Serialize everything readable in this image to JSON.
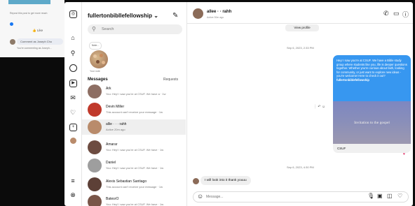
{
  "background": {
    "line1": "Repost this post to get more reach",
    "like_label": "Like",
    "comment_as": "Comment as Joseph Cho",
    "commenting_note": "You're commenting as Joseph..."
  },
  "sidebar_list": {
    "account_name": "fullertonbibllefellowship",
    "search_placeholder": "Search",
    "note_bubble": "Note...",
    "note_label": "Your note",
    "messages_header": "Messages",
    "requests_header": "Requests"
  },
  "conversations": [
    {
      "name": "Ark",
      "preview": "You: Hey! I saw you're at CSUF. We have a · 1w",
      "color": "#8d6e63"
    },
    {
      "name": "Devin Miller",
      "preview": "This account can't receive your message · 1w",
      "color": "#c0392b"
    },
    {
      "name": "allie  ·  ·  ·  rahh",
      "preview": "Active 20m ago",
      "color": "#b98b6b"
    },
    {
      "name": "Amarar",
      "preview": "You: Hey! I saw you're at CSUF. We have · 1w",
      "color": "#6d4c41"
    },
    {
      "name": "Daniel",
      "preview": "You: Hey! I saw you're at CSUF. We have · 1w",
      "color": "#9e9e9e"
    },
    {
      "name": "Alexis Sebastian Santiago",
      "preview": "This account can't receive your message · 1w",
      "color": "#5d4037"
    },
    {
      "name": "BatesrO",
      "preview": "You: Hey! I saw you're at CSUF. We have · 1w",
      "color": "#795548"
    }
  ],
  "chat": {
    "header_name": "allee  ·  ·  rahh",
    "header_sub": "Active 30m ago",
    "view_profile": "View profile",
    "timestamp1": "Sep 6, 2023, 2:33 PM",
    "timestamp2": "Sep 6, 2023, 4:30 PM",
    "sent_message_body": "Hey! I saw you're at CSUF. We have a Bible study group where students like you, life is deeper questions together. Whether you're curious about faith, looking for community, or just want to explore new ideas - you're welcome! Here to check it out? ",
    "sent_message_link": "fullertonbiblefellowship",
    "card_image_text": "Invitation to the gospel",
    "card_footer": "CSUF",
    "received_message": "I will look into it thank youuu",
    "composer_placeholder": "Message..."
  },
  "icons": {
    "rail": [
      "instagram-icon",
      "home-icon",
      "search-icon",
      "explore-icon",
      "reels-icon",
      "messages-icon",
      "heart-icon",
      "create-icon",
      "profile-icon",
      "menu-icon",
      "threads-icon"
    ],
    "header": [
      "phone-icon",
      "video-icon",
      "info-icon"
    ],
    "composer": [
      "emoji-icon",
      "mic-icon",
      "image-icon",
      "sticker-icon",
      "heart-icon"
    ]
  },
  "colors": {
    "accent_blue": "#3797f0",
    "heart_red": "#e0245e",
    "bg_dark": "#0b0b0b"
  }
}
